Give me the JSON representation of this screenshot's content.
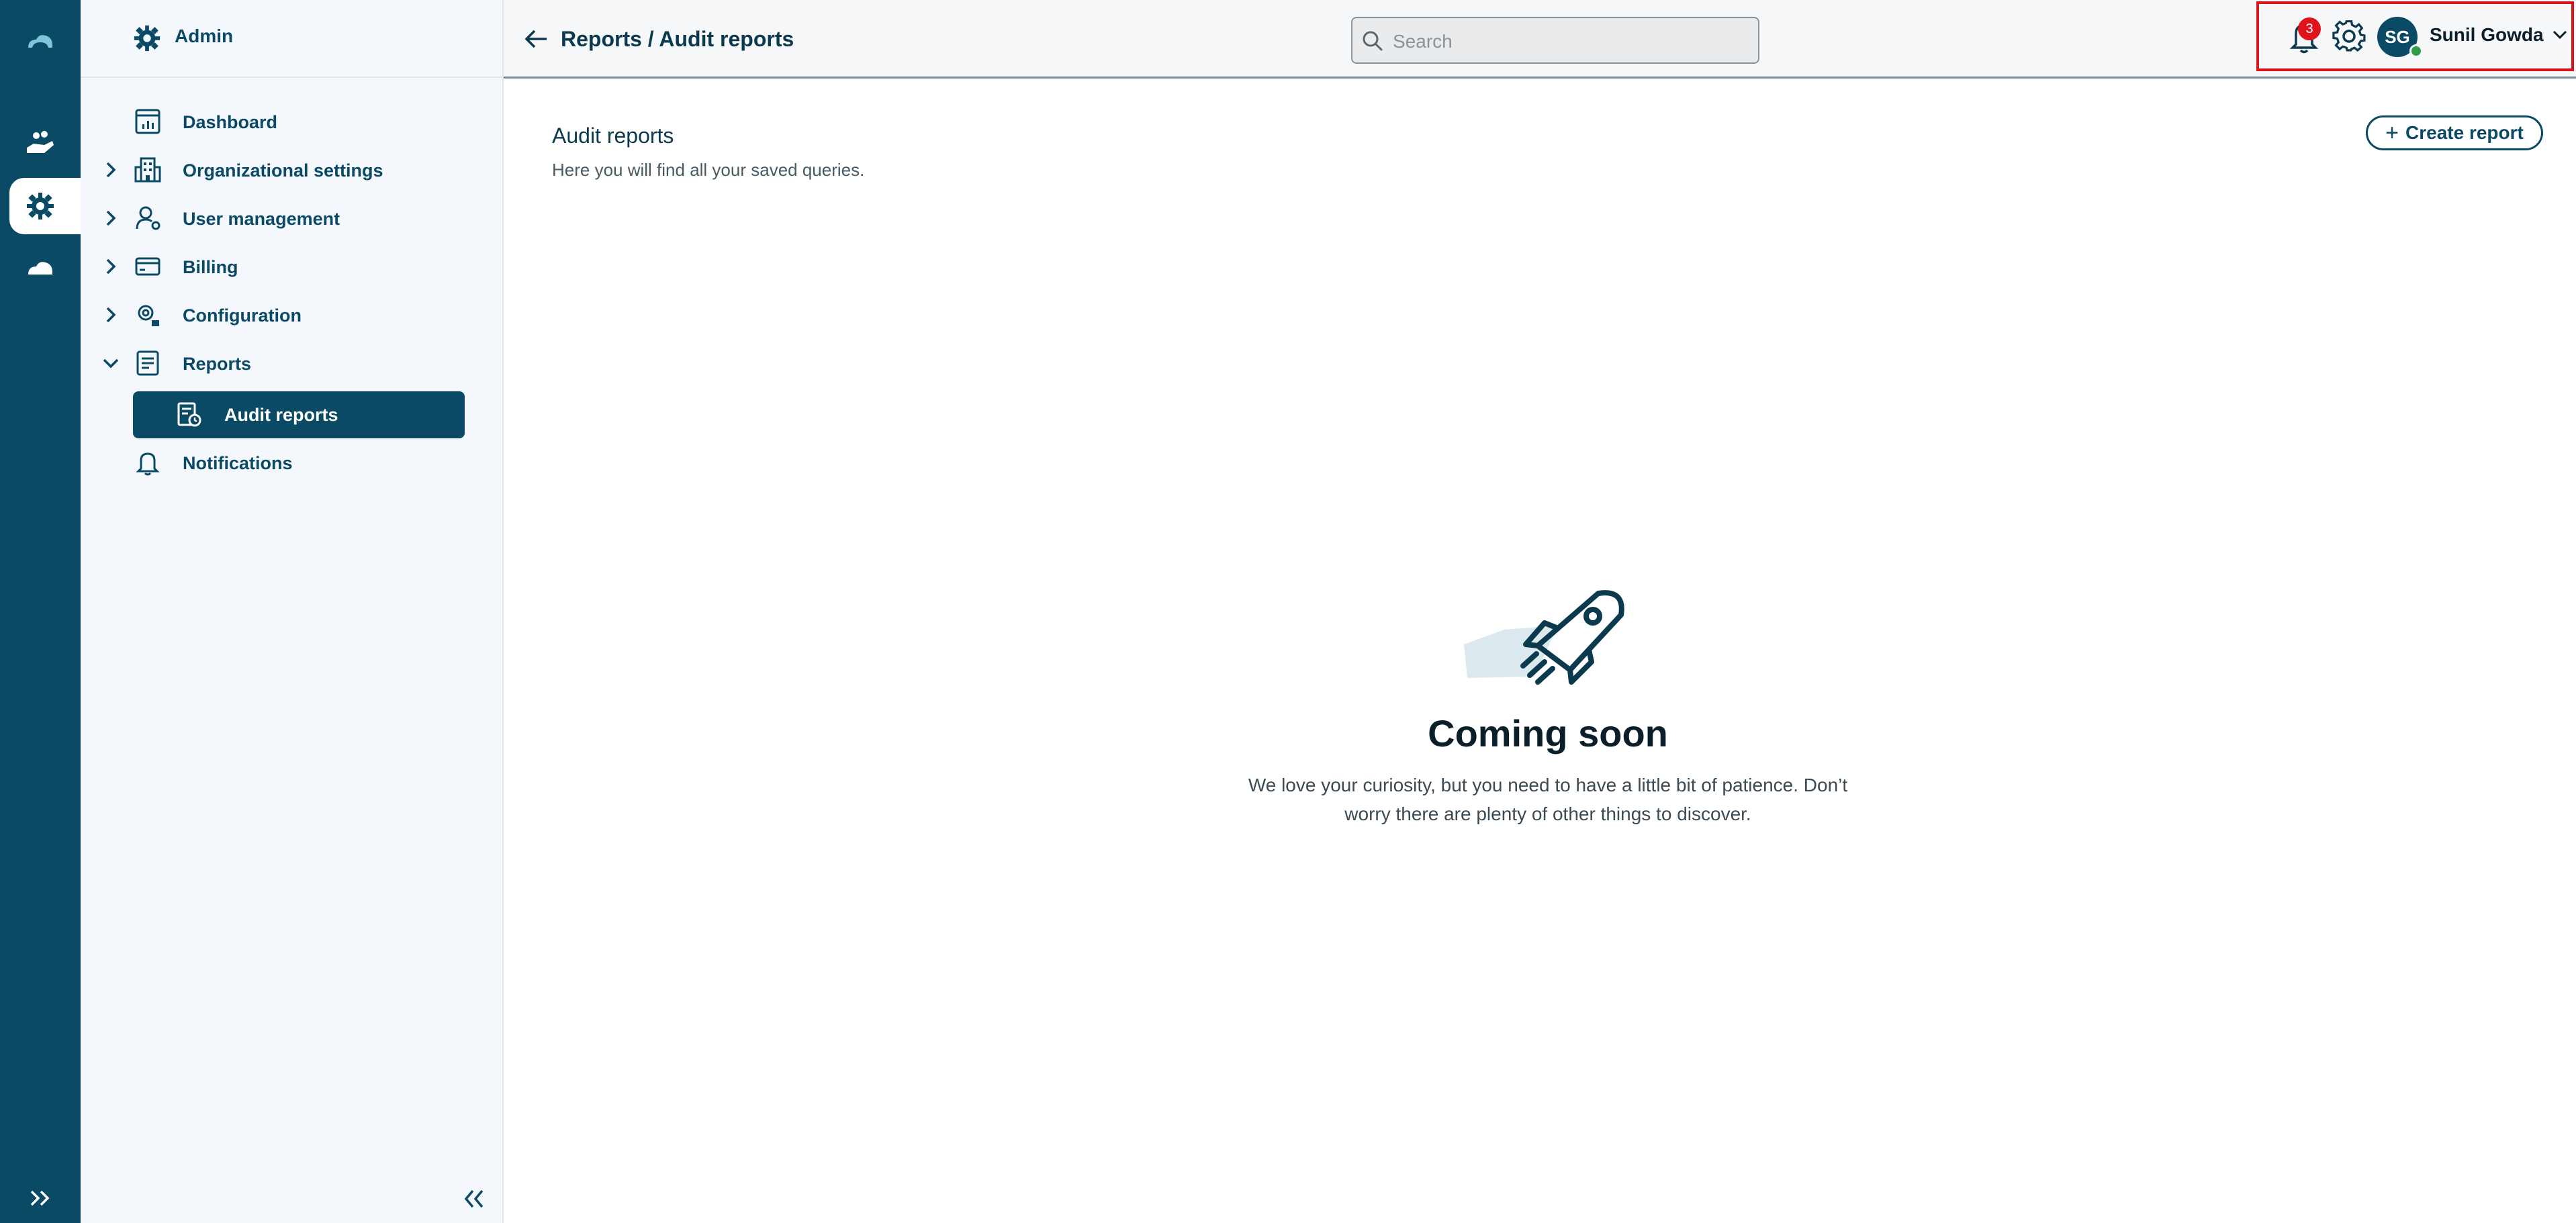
{
  "rail": {
    "icons": [
      "cloud-logo-icon",
      "hand-coins-icon",
      "admin-gear-icon",
      "cloud-icon",
      "expand-icon"
    ]
  },
  "sidebar": {
    "title": "Admin",
    "items": [
      {
        "label": "Dashboard",
        "icon": "dashboard-icon",
        "expandable": false
      },
      {
        "label": "Organizational settings",
        "icon": "building-icon",
        "expandable": true
      },
      {
        "label": "User management",
        "icon": "user-gear-icon",
        "expandable": true
      },
      {
        "label": "Billing",
        "icon": "credit-card-icon",
        "expandable": true
      },
      {
        "label": "Configuration",
        "icon": "config-gear-icon",
        "expandable": true
      },
      {
        "label": "Reports",
        "icon": "report-icon",
        "expandable": true,
        "expanded": true
      },
      {
        "label": "Audit reports",
        "icon": "audit-report-icon",
        "active": true
      },
      {
        "label": "Notifications",
        "icon": "bell-icon",
        "expandable": false
      }
    ]
  },
  "topbar": {
    "breadcrumb": "Reports / Audit reports",
    "search_placeholder": "Search",
    "notification_count": "3",
    "avatar_initials": "SG",
    "user_name": "Sunil Gowda"
  },
  "main": {
    "heading": "Audit reports",
    "subheading": "Here you will find all your saved queries.",
    "create_button": "Create report",
    "empty_title": "Coming soon",
    "empty_text_line1": "We love your curiosity, but you need to have a little bit of patience. Don’t",
    "empty_text_line2": "worry there are plenty of other things to discover."
  },
  "colors": {
    "brand": "#0b4a64",
    "sidebar_bg": "#f4f8fc",
    "badge": "#e0131b",
    "highlight": "#d9141b"
  }
}
